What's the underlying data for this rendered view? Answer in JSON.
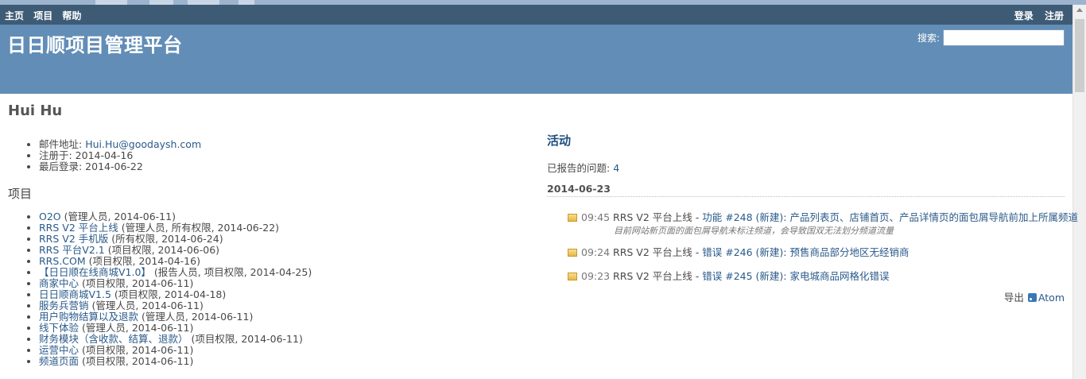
{
  "top_menu": {
    "left": [
      "主页",
      "项目",
      "帮助"
    ],
    "right": [
      "登录",
      "注册"
    ]
  },
  "header": {
    "title": "日日顺项目管理平台",
    "search_label": "搜索:",
    "search_value": ""
  },
  "user": {
    "name": "Hui Hu",
    "email_label": "邮件地址:",
    "email": "Hui.Hu@goodaysh.com",
    "registered": "注册于: 2014-04-16",
    "last_login": "最后登录: 2014-06-22"
  },
  "projects": {
    "title": "项目",
    "items": [
      {
        "name": "O2O",
        "info": " (管理人员, 2014-06-11)"
      },
      {
        "name": "RRS V2 平台上线",
        "info": " (管理人员, 所有权限, 2014-06-22)"
      },
      {
        "name": "RRS V2 手机版",
        "info": " (所有权限, 2014-06-24)"
      },
      {
        "name": "RRS 平台V2.1",
        "info": " (项目权限, 2014-06-06)"
      },
      {
        "name": "RRS.COM",
        "info": " (项目权限, 2014-04-16)"
      },
      {
        "name": "【日日顺在线商城V1.0】",
        "info": " (报告人员, 项目权限, 2014-04-25)"
      },
      {
        "name": "商家中心",
        "info": " (项目权限, 2014-06-11)"
      },
      {
        "name": "日日顺商城V1.5",
        "info": " (项目权限, 2014-04-18)"
      },
      {
        "name": "服务兵营销",
        "info": " (管理人员, 2014-06-11)"
      },
      {
        "name": "用户购物结算以及退款",
        "info": " (管理人员, 2014-06-11)"
      },
      {
        "name": "线下体验",
        "info": " (管理人员, 2014-06-11)"
      },
      {
        "name": "财务模块（含收款、结算、退款）",
        "info": " (项目权限, 2014-06-11)"
      },
      {
        "name": "运营中心",
        "info": " (项目权限, 2014-06-11)"
      },
      {
        "name": "频道页面",
        "info": " (项目权限, 2014-06-11)"
      }
    ]
  },
  "activity": {
    "title": "活动",
    "reported_label": "已报告的问题:",
    "reported_count": "4",
    "date": "2014-06-23",
    "items": [
      {
        "time": "09:45",
        "project": "RRS V2 平台上线",
        "sep": " - ",
        "link": "功能 #248 (新建): 产品列表页、店铺首页、产品详情页的面包屑导航前加上所属频道",
        "desc": "目前网站新页面的面包屑导航未标注频道，会导致国双无法划分频道流量"
      },
      {
        "time": "09:24",
        "project": "RRS V2 平台上线",
        "sep": " - ",
        "link": "错误 #246 (新建): 预售商品部分地区无经销商",
        "desc": ""
      },
      {
        "time": "09:23",
        "project": "RRS V2 平台上线",
        "sep": " - ",
        "link": "错误 #245 (新建): 家电城商品网格化错误",
        "desc": ""
      }
    ]
  },
  "export": {
    "label": "导出",
    "atom": "Atom"
  }
}
